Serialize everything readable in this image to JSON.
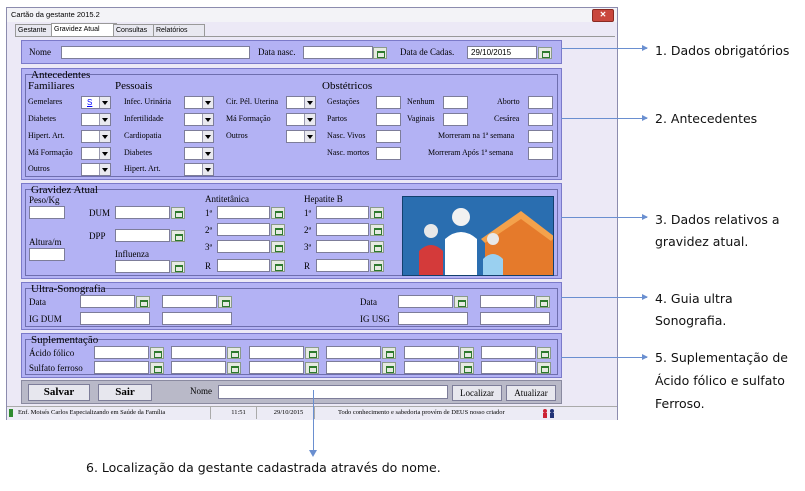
{
  "window": {
    "title": "Cartão da gestante 2015.2",
    "close_glyph": "✕"
  },
  "tabs": [
    "Gestante",
    "Gravidez Atual",
    "Consultas",
    "Relatórios"
  ],
  "top": {
    "nome_label": "Nome",
    "data_nasc_label": "Data nasc.",
    "data_cadas_label": "Data de Cadas.",
    "data_cadas_value": "29/10/2015"
  },
  "antecedentes": {
    "title": "Antecedentes",
    "familiares_title": "Familiares",
    "pessoais_title": "Pessoais",
    "obstetricos_title": "Obstétricos",
    "familiares": [
      "Gemelares",
      "Diabetes",
      "Hipert. Art.",
      "Má Formação",
      "Outros"
    ],
    "gemelares_value": "S",
    "pessoais": [
      "Infec. Urinária",
      "Infertilidade",
      "Cardiopatia",
      "Diabetes",
      "Hipert. Art."
    ],
    "pessoais2": [
      "Cir. Pél. Uterina",
      "Má Formação",
      "Outros"
    ],
    "obst_left": [
      "Gestações",
      "Partos",
      "Nasc. Vivos",
      "Nasc. mortos"
    ],
    "obst_mid": [
      "Nenhum",
      "Vaginais"
    ],
    "obst_right": [
      "Aborto",
      "Cesárea",
      "Morreram na 1ª semana",
      "Morreram Após 1ª semana"
    ]
  },
  "gravidez": {
    "title": "Gravidez Atual",
    "peso": "Peso/Kg",
    "altura": "Altura/m",
    "dum": "DUM",
    "dpp": "DPP",
    "influenza": "Influenza",
    "antitetanica": "Antitetânica",
    "hepatite": "Hepatite B",
    "doses": [
      "1ª",
      "2ª",
      "3ª",
      "R"
    ]
  },
  "ultra": {
    "title": "Ultra-Sonografia",
    "data": "Data",
    "ig_dum": "IG DUM",
    "data2": "Data",
    "ig_usg": "IG USG"
  },
  "suplementacao": {
    "title": "Suplementação",
    "acido": "Ácido fólico",
    "sulfato": "Sulfato ferroso"
  },
  "bottom": {
    "salvar": "Salvar",
    "sair": "Sair",
    "nome_label": "Nome",
    "localizar": "Localizar",
    "atualizar": "Atualizar"
  },
  "statusbar": {
    "author": "Enf. Moisés Carlos Especializando em Saúde da Família",
    "time": "11:51",
    "date": "29/10/2015",
    "motto": "Todo conhecimento e sabedoria provém de DEUS nosso criador"
  },
  "annotations": [
    "1. Dados obrigatórios",
    "2. Antecedentes",
    "3. Dados relativos a",
    "gravidez atual.",
    "4.   Guia ultra",
    "Sonografia.",
    "5. Suplementação de",
    "Ácido fólico e sulfato",
    "Ferroso.",
    "6. Localização da gestante cadastrada através do nome."
  ],
  "icons": [
    "calendar-icon",
    "dropdown-arrow-icon",
    "family-house-image",
    "close-icon"
  ]
}
